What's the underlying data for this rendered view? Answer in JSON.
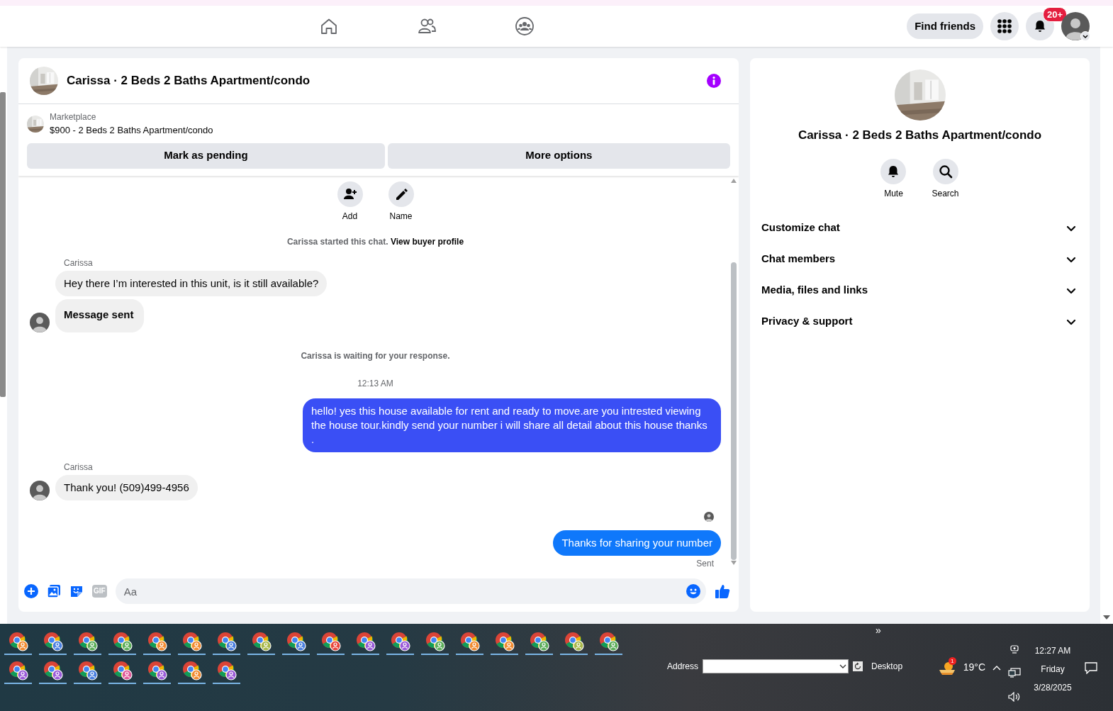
{
  "top_bar": {
    "find_friends": "Find friends",
    "notification_count": "20+"
  },
  "chat": {
    "title": "Carissa · 2 Beds 2 Baths Apartment/condo",
    "listing": {
      "label": "Marketplace",
      "title": "$900 - 2 Beds 2 Baths Apartment/condo"
    },
    "buttons": [
      "Mark as pending",
      "More options"
    ],
    "quick_actions": [
      "Add",
      "Name"
    ],
    "messages": [
      {
        "kind": "system",
        "text": "Carissa started this chat.",
        "link": "View buyer profile"
      },
      {
        "kind": "incoming",
        "sender": "Carissa",
        "bubbles": [
          {
            "kind": "text",
            "text": "Hey there I’m interested in this unit, is it still available?"
          },
          {
            "kind": "notice",
            "text": "Message sent"
          }
        ]
      },
      {
        "kind": "system",
        "text": "Carissa is waiting for your response."
      },
      {
        "kind": "timestamp",
        "text": "12:13 AM"
      },
      {
        "kind": "outgoing",
        "text": "hello! yes this house available for rent and ready to move.are you intrested viewing the house tour.kindly send your number i will share all detail about this house thanks .",
        "color": "#3a4ff5"
      },
      {
        "kind": "incoming",
        "sender": "Carissa",
        "bubbles": [
          {
            "kind": "text",
            "text": "Thank you! (509)499-4956"
          }
        ]
      },
      {
        "kind": "seen"
      },
      {
        "kind": "outgoing",
        "text": "Thanks for sharing your number",
        "color": "#0f78fb",
        "status": "Sent"
      }
    ],
    "composer": {
      "gif": "GIF",
      "placeholder": "Aa"
    }
  },
  "details": {
    "title": "Carissa · 2 Beds 2 Baths Apartment/condo",
    "actions": [
      "Mute",
      "Search"
    ],
    "sections": [
      {
        "label": "Customize chat",
        "expanded": false
      },
      {
        "label": "Chat members",
        "expanded": false
      },
      {
        "label": "Media, files and links",
        "expanded": false
      },
      {
        "label": "Privacy & support",
        "expanded": false
      }
    ]
  },
  "taskbar": {
    "apps": [
      {
        "color": "#f28b30"
      },
      {
        "color": "#4a7fe0"
      },
      {
        "color": "#5cae5a"
      },
      {
        "color": "#5cae5a"
      },
      {
        "color": "#f28b30"
      },
      {
        "color": "#f28b30"
      },
      {
        "color": "#4a7fe0"
      },
      {
        "color": "#a8b84a"
      },
      {
        "color": "#4a7fe0"
      },
      {
        "color": "#e8453c"
      },
      {
        "color": "#9a5ad8"
      },
      {
        "color": "#9a5ad8"
      },
      {
        "color": "#5cae5a"
      },
      {
        "color": "#f28b30"
      },
      {
        "color": "#f28b30"
      },
      {
        "color": "#5cae5a"
      },
      {
        "color": "#a8b84a"
      },
      {
        "color": "#5cae5a"
      },
      {
        "color": "#9a5ad8"
      },
      {
        "color": "#9a5ad8"
      },
      {
        "color": "#4a7fe0"
      },
      {
        "color": "#e05a9a"
      },
      {
        "color": "#9a5ad8"
      },
      {
        "color": "#f28b30"
      },
      {
        "color": "#9a5ad8"
      }
    ],
    "overflow": "»",
    "address_label": "Address",
    "desktop": "Desktop",
    "weather_badge": "1",
    "temperature": "19°C",
    "time": "12:27 AM",
    "day": "Friday",
    "date": "3/28/2025"
  }
}
